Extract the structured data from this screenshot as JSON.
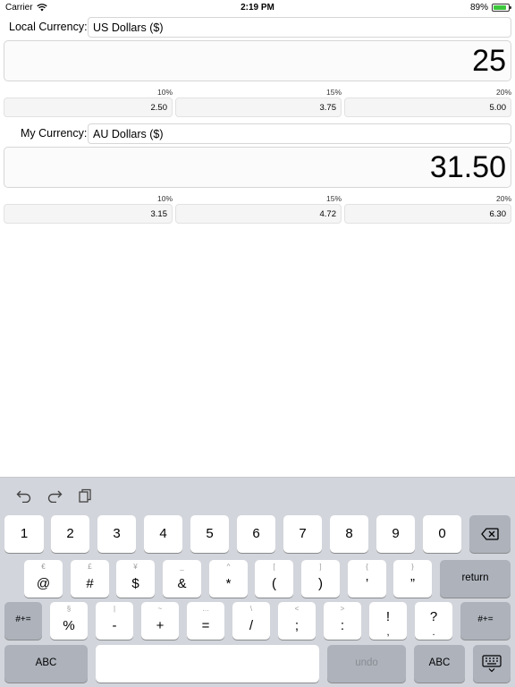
{
  "status": {
    "carrier": "Carrier",
    "time": "2:19 PM",
    "battery": "89%",
    "battery_level": 0.89
  },
  "local": {
    "label": "Local Currency:",
    "currency": "US Dollars ($)",
    "amount": "25",
    "tips": [
      {
        "pct": "10%",
        "value": "2.50"
      },
      {
        "pct": "15%",
        "value": "3.75"
      },
      {
        "pct": "20%",
        "value": "5.00"
      }
    ]
  },
  "mine": {
    "label": "My Currency:",
    "currency": "AU Dollars ($)",
    "amount": "31.50",
    "tips": [
      {
        "pct": "10%",
        "value": "3.15"
      },
      {
        "pct": "15%",
        "value": "4.72"
      },
      {
        "pct": "20%",
        "value": "6.30"
      }
    ]
  },
  "keyboard": {
    "toolbar_icons": [
      "undo-icon",
      "redo-icon",
      "paste-icon"
    ],
    "row1": [
      "1",
      "2",
      "3",
      "4",
      "5",
      "6",
      "7",
      "8",
      "9",
      "0"
    ],
    "row2": [
      {
        "main": "@",
        "alt": "€"
      },
      {
        "main": "#",
        "alt": "£"
      },
      {
        "main": "$",
        "alt": "¥"
      },
      {
        "main": "&",
        "alt": "_"
      },
      {
        "main": "*",
        "alt": "^"
      },
      {
        "main": "(",
        "alt": "["
      },
      {
        "main": ")",
        "alt": "]"
      },
      {
        "main": "’",
        "alt": "{"
      },
      {
        "main": "”",
        "alt": "}"
      }
    ],
    "row3": [
      {
        "main": "%",
        "alt": "§"
      },
      {
        "main": "-",
        "alt": "|"
      },
      {
        "main": "+",
        "alt": "~"
      },
      {
        "main": "=",
        "alt": "…"
      },
      {
        "main": "/",
        "alt": "\\"
      },
      {
        "main": ";",
        "alt": "<"
      },
      {
        "main": ":",
        "alt": ">"
      },
      {
        "main": "!",
        "alt": "!"
      },
      {
        "main": "?",
        "alt": "?"
      }
    ],
    "return_label": "return",
    "symbols_label": "#+=",
    "abc_label": "ABC",
    "undo_label": "undo",
    "delete_icon": "backspace-icon",
    "dismiss_icon": "keyboard-dismiss-icon"
  }
}
